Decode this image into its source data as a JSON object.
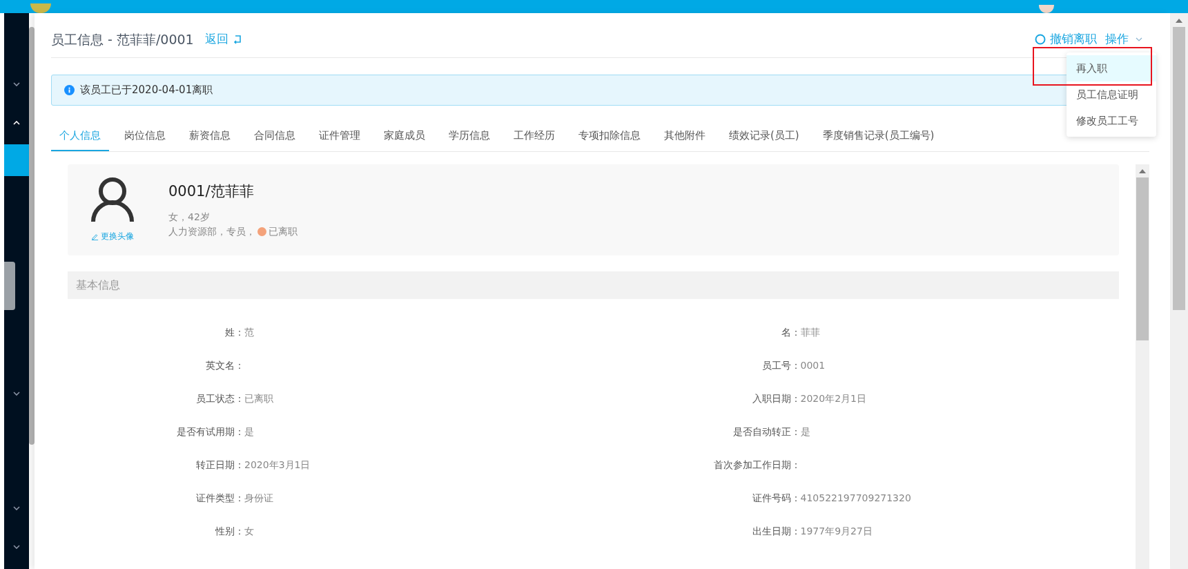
{
  "header": {
    "title": "员工信息 - 范菲菲/0001",
    "back_link": "返回"
  },
  "actions": {
    "cancel_resignation": "撤销离职",
    "operations": "操作"
  },
  "dropdown": [
    {
      "label": "再入职",
      "selected": true
    },
    {
      "label": "员工信息证明",
      "selected": false
    },
    {
      "label": "修改员工工号",
      "selected": false
    }
  ],
  "alert": {
    "text": "该员工已于2020-04-01离职"
  },
  "tabs": [
    {
      "label": "个人信息",
      "selected": true
    },
    {
      "label": "岗位信息",
      "selected": false
    },
    {
      "label": "薪资信息",
      "selected": false
    },
    {
      "label": "合同信息",
      "selected": false
    },
    {
      "label": "证件管理",
      "selected": false
    },
    {
      "label": "家庭成员",
      "selected": false
    },
    {
      "label": "学历信息",
      "selected": false
    },
    {
      "label": "工作经历",
      "selected": false
    },
    {
      "label": "专项扣除信息",
      "selected": false
    },
    {
      "label": "其他附件",
      "selected": false
    },
    {
      "label": "绩效记录(员工)",
      "selected": false
    },
    {
      "label": "季度销售记录(员工编号)",
      "selected": false
    }
  ],
  "profile": {
    "change_avatar": "更换头像",
    "name": "0001/范菲菲",
    "gender_age": "女，42岁",
    "position": "人力资源部，专员，",
    "statuses": [
      {
        "label": "已离职",
        "color": "#f4a27a"
      }
    ]
  },
  "section": {
    "title": "基本信息"
  },
  "fields": [
    {
      "label": "姓：",
      "value": "范"
    },
    {
      "label": "名：",
      "value": "菲菲"
    },
    {
      "label": "英文名："
    },
    {
      "label": "员工号：",
      "value": "0001"
    },
    {
      "label": "员工状态：",
      "value": "已离职"
    },
    {
      "label": "入职日期：",
      "value": "2020年2月1日"
    },
    {
      "label": "是否有试用期：",
      "value": "是"
    },
    {
      "label": "是否自动转正：",
      "value": "是"
    },
    {
      "label": "转正日期：",
      "value": "2020年3月1日"
    },
    {
      "label": "首次参加工作日期："
    },
    {
      "label": "证件类型：",
      "value": "身份证"
    },
    {
      "label": "证件号码：",
      "value": "410522197709271320"
    },
    {
      "label": "性别：",
      "value": "女"
    },
    {
      "label": "出生日期：",
      "value": "1977年9月27日"
    }
  ]
}
